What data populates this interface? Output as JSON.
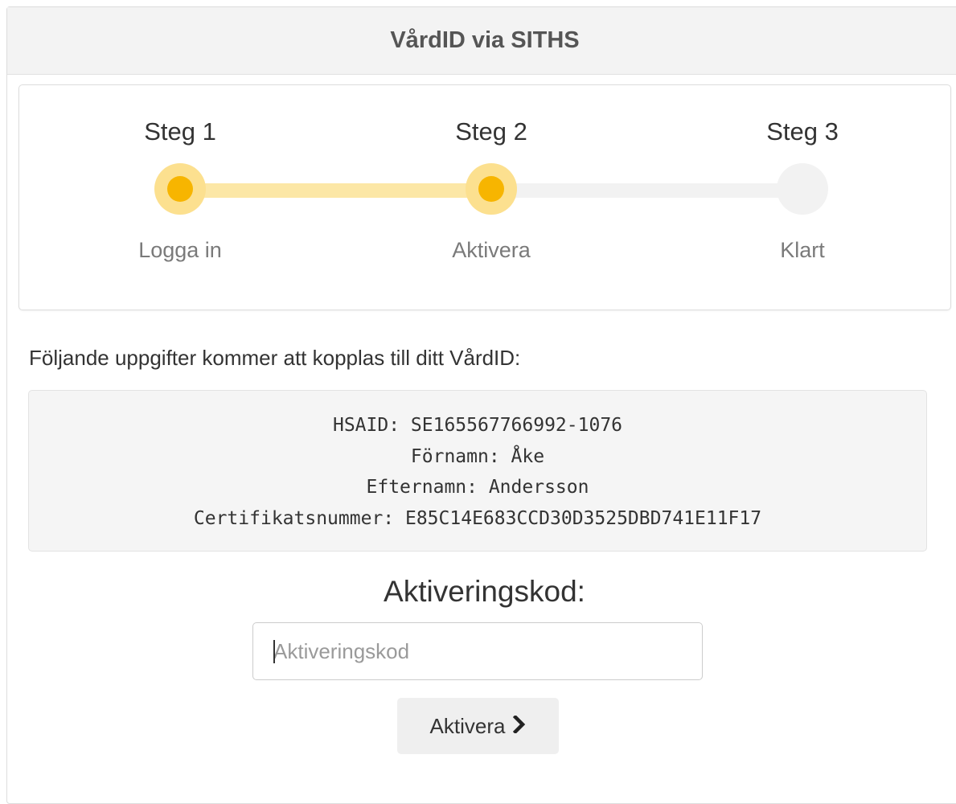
{
  "header": {
    "title": "VårdID via SITHS"
  },
  "steps": [
    {
      "title": "Steg 1",
      "label": "Logga in",
      "state": "completed"
    },
    {
      "title": "Steg 2",
      "label": "Aktivera",
      "state": "current"
    },
    {
      "title": "Steg 3",
      "label": "Klart",
      "state": "pending"
    }
  ],
  "colors": {
    "step_active": "#f7b500",
    "step_active_halo": "#fce08f",
    "track_done": "#fce7a6",
    "track_todo": "#f2f2f2"
  },
  "info": {
    "intro": "Följande uppgifter kommer att kopplas till ditt VårdID:",
    "hsaid": "HSAID: SE165567766992-1076",
    "first_name": "Förnamn: Åke",
    "last_name": "Efternamn: Andersson",
    "certificate": "Certifikatsnummer: E85C14E683CCD30D3525DBD741E11F17"
  },
  "activation": {
    "heading": "Aktiveringskod:",
    "input_placeholder": "Aktiveringskod",
    "input_value": "",
    "button_label": "Aktivera",
    "button_icon": "chevron-right-icon"
  }
}
